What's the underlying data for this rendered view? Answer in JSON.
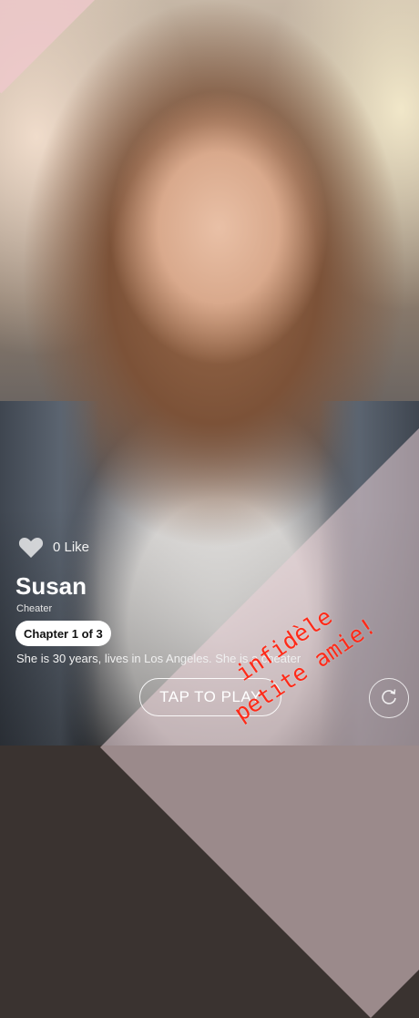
{
  "profile": {
    "likes": "0 Like",
    "name": "Susan",
    "tagline": "Cheater",
    "chapter": "Chapter 1 of 3",
    "description": "She is 30 years, lives in Los Angeles. She is a cheater"
  },
  "actions": {
    "play_label": "TAP TO PLAY",
    "replay_icon": "replay-icon"
  },
  "overlay": {
    "line1": "infidèle",
    "line2": "petite amie!"
  },
  "colors": {
    "overlay_text": "#ff2a18",
    "banner": "#f0c8cd"
  }
}
